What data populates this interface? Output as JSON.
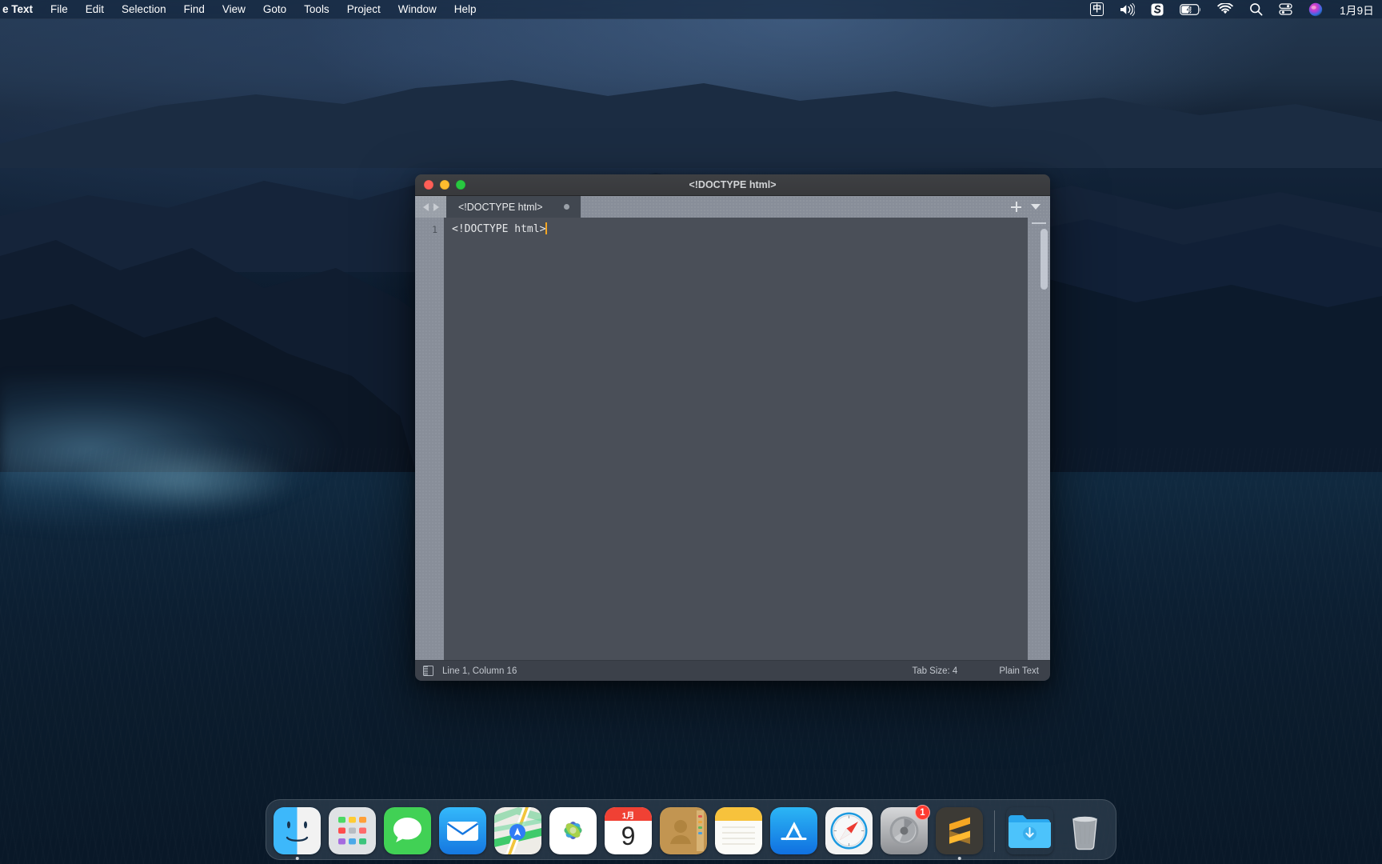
{
  "menubar": {
    "app_name": "e Text",
    "items": [
      "File",
      "Edit",
      "Selection",
      "Find",
      "View",
      "Goto",
      "Tools",
      "Project",
      "Window",
      "Help"
    ],
    "status_items": [
      {
        "name": "input-method-icon",
        "label": "中"
      },
      {
        "name": "volume-icon",
        "label": ""
      },
      {
        "name": "sogou-input-icon",
        "label": "S"
      },
      {
        "name": "battery-charging-icon",
        "label": ""
      },
      {
        "name": "wifi-icon",
        "label": ""
      },
      {
        "name": "spotlight-search-icon",
        "label": ""
      },
      {
        "name": "control-center-icon",
        "label": ""
      },
      {
        "name": "siri-icon",
        "label": ""
      }
    ],
    "date": "1月9日"
  },
  "window": {
    "title": "<!DOCTYPE html>",
    "traffic_lights": [
      "close",
      "minimize",
      "zoom"
    ]
  },
  "tabbar": {
    "tab_label": "<!DOCTYPE html>",
    "dirty_indicator": true,
    "new_tab_label": "+",
    "dropdown_label": "▼"
  },
  "editor": {
    "lines": [
      {
        "number": "1",
        "text": "<!DOCTYPE html>"
      }
    ]
  },
  "statusbar": {
    "sidebar_toggle": "sidebar-toggle-icon",
    "cursor_position": "Line 1, Column 16",
    "tab_size": "Tab Size: 4",
    "syntax": "Plain Text"
  },
  "dock": {
    "items": [
      {
        "name": "finder",
        "label": "Finder",
        "running": true
      },
      {
        "name": "launchpad",
        "label": "Launchpad",
        "running": false
      },
      {
        "name": "messages",
        "label": "Messages",
        "running": false
      },
      {
        "name": "mail",
        "label": "Mail",
        "running": false
      },
      {
        "name": "maps",
        "label": "Maps",
        "running": false
      },
      {
        "name": "photos",
        "label": "Photos",
        "running": false
      },
      {
        "name": "calendar",
        "label": "Calendar",
        "running": false,
        "month": "1月",
        "day": "9"
      },
      {
        "name": "contacts",
        "label": "Contacts",
        "running": false
      },
      {
        "name": "notes",
        "label": "Notes",
        "running": false
      },
      {
        "name": "app-store",
        "label": "App Store",
        "running": false
      },
      {
        "name": "safari",
        "label": "Safari",
        "running": false
      },
      {
        "name": "system-preferences",
        "label": "System Preferences",
        "running": false,
        "badge": "1"
      },
      {
        "name": "sublime-text",
        "label": "Sublime Text",
        "running": true
      }
    ],
    "folders": [
      {
        "name": "downloads-folder",
        "label": "Downloads"
      },
      {
        "name": "trash",
        "label": "Trash"
      }
    ]
  },
  "colors": {
    "accent_cursor": "#f5a623",
    "tab_active": "#414750",
    "editor_bg": "#4a4f58",
    "statusbar_bg": "#3c414a",
    "badge_red": "#ff3b30"
  }
}
